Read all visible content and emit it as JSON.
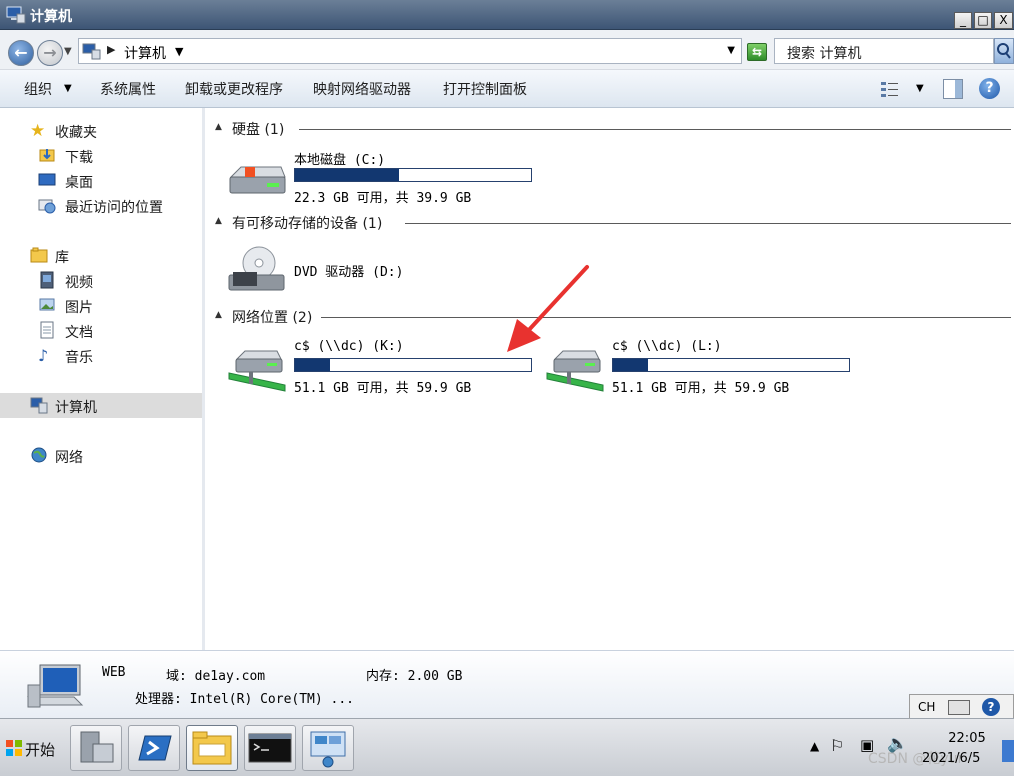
{
  "window": {
    "title": "计算机",
    "btn_min": "_",
    "btn_max": "□",
    "btn_close": "X"
  },
  "address": {
    "path": "计算机",
    "search_placeholder": "搜索 计算机"
  },
  "toolbar": {
    "organize": "组织",
    "system_properties": "系统属性",
    "uninstall": "卸载或更改程序",
    "map_drive": "映射网络驱动器",
    "control_panel": "打开控制面板"
  },
  "nav": {
    "favorites": "收藏夹",
    "downloads": "下载",
    "desktop": "桌面",
    "recent": "最近访问的位置",
    "libraries": "库",
    "videos": "视频",
    "pictures": "图片",
    "documents": "文档",
    "music": "音乐",
    "computer": "计算机",
    "network": "网络"
  },
  "groups": {
    "hard_disks": "硬盘 (1)",
    "removable": "有可移动存储的设备 (1)",
    "network": "网络位置 (2)"
  },
  "drives": [
    {
      "name": "本地磁盘 (C:)",
      "size": "22.3 GB 可用，共 39.9 GB",
      "used_fraction": 0.44
    },
    {
      "name": "DVD 驱动器 (D:)"
    },
    {
      "name": "c$ (\\\\dc) (K:)",
      "size": "51.1 GB 可用，共 59.9 GB",
      "used_fraction": 0.15
    },
    {
      "name": "c$ (\\\\dc) (L:)",
      "size": "51.1 GB 可用，共 59.9 GB",
      "used_fraction": 0.15
    }
  ],
  "details": {
    "computer_name": "WEB",
    "domain": "域: de1ay.com",
    "memory": "内存: 2.00 GB",
    "processor": "处理器: Intel(R) Core(TM) ..."
  },
  "language": {
    "code": "CH"
  },
  "taskbar": {
    "start_label": "开始",
    "time": "22:05",
    "date": "2021/6/5",
    "watermark": "CSDN @花yui"
  },
  "icons": {
    "computer": "computer-icon",
    "hdd": "hard-drive-icon",
    "dvd": "dvd-drive-icon",
    "network_drive": "network-drive-icon"
  },
  "colors": {
    "capacity_fill": "#123770",
    "annotation_arrow": "#e8322f"
  }
}
